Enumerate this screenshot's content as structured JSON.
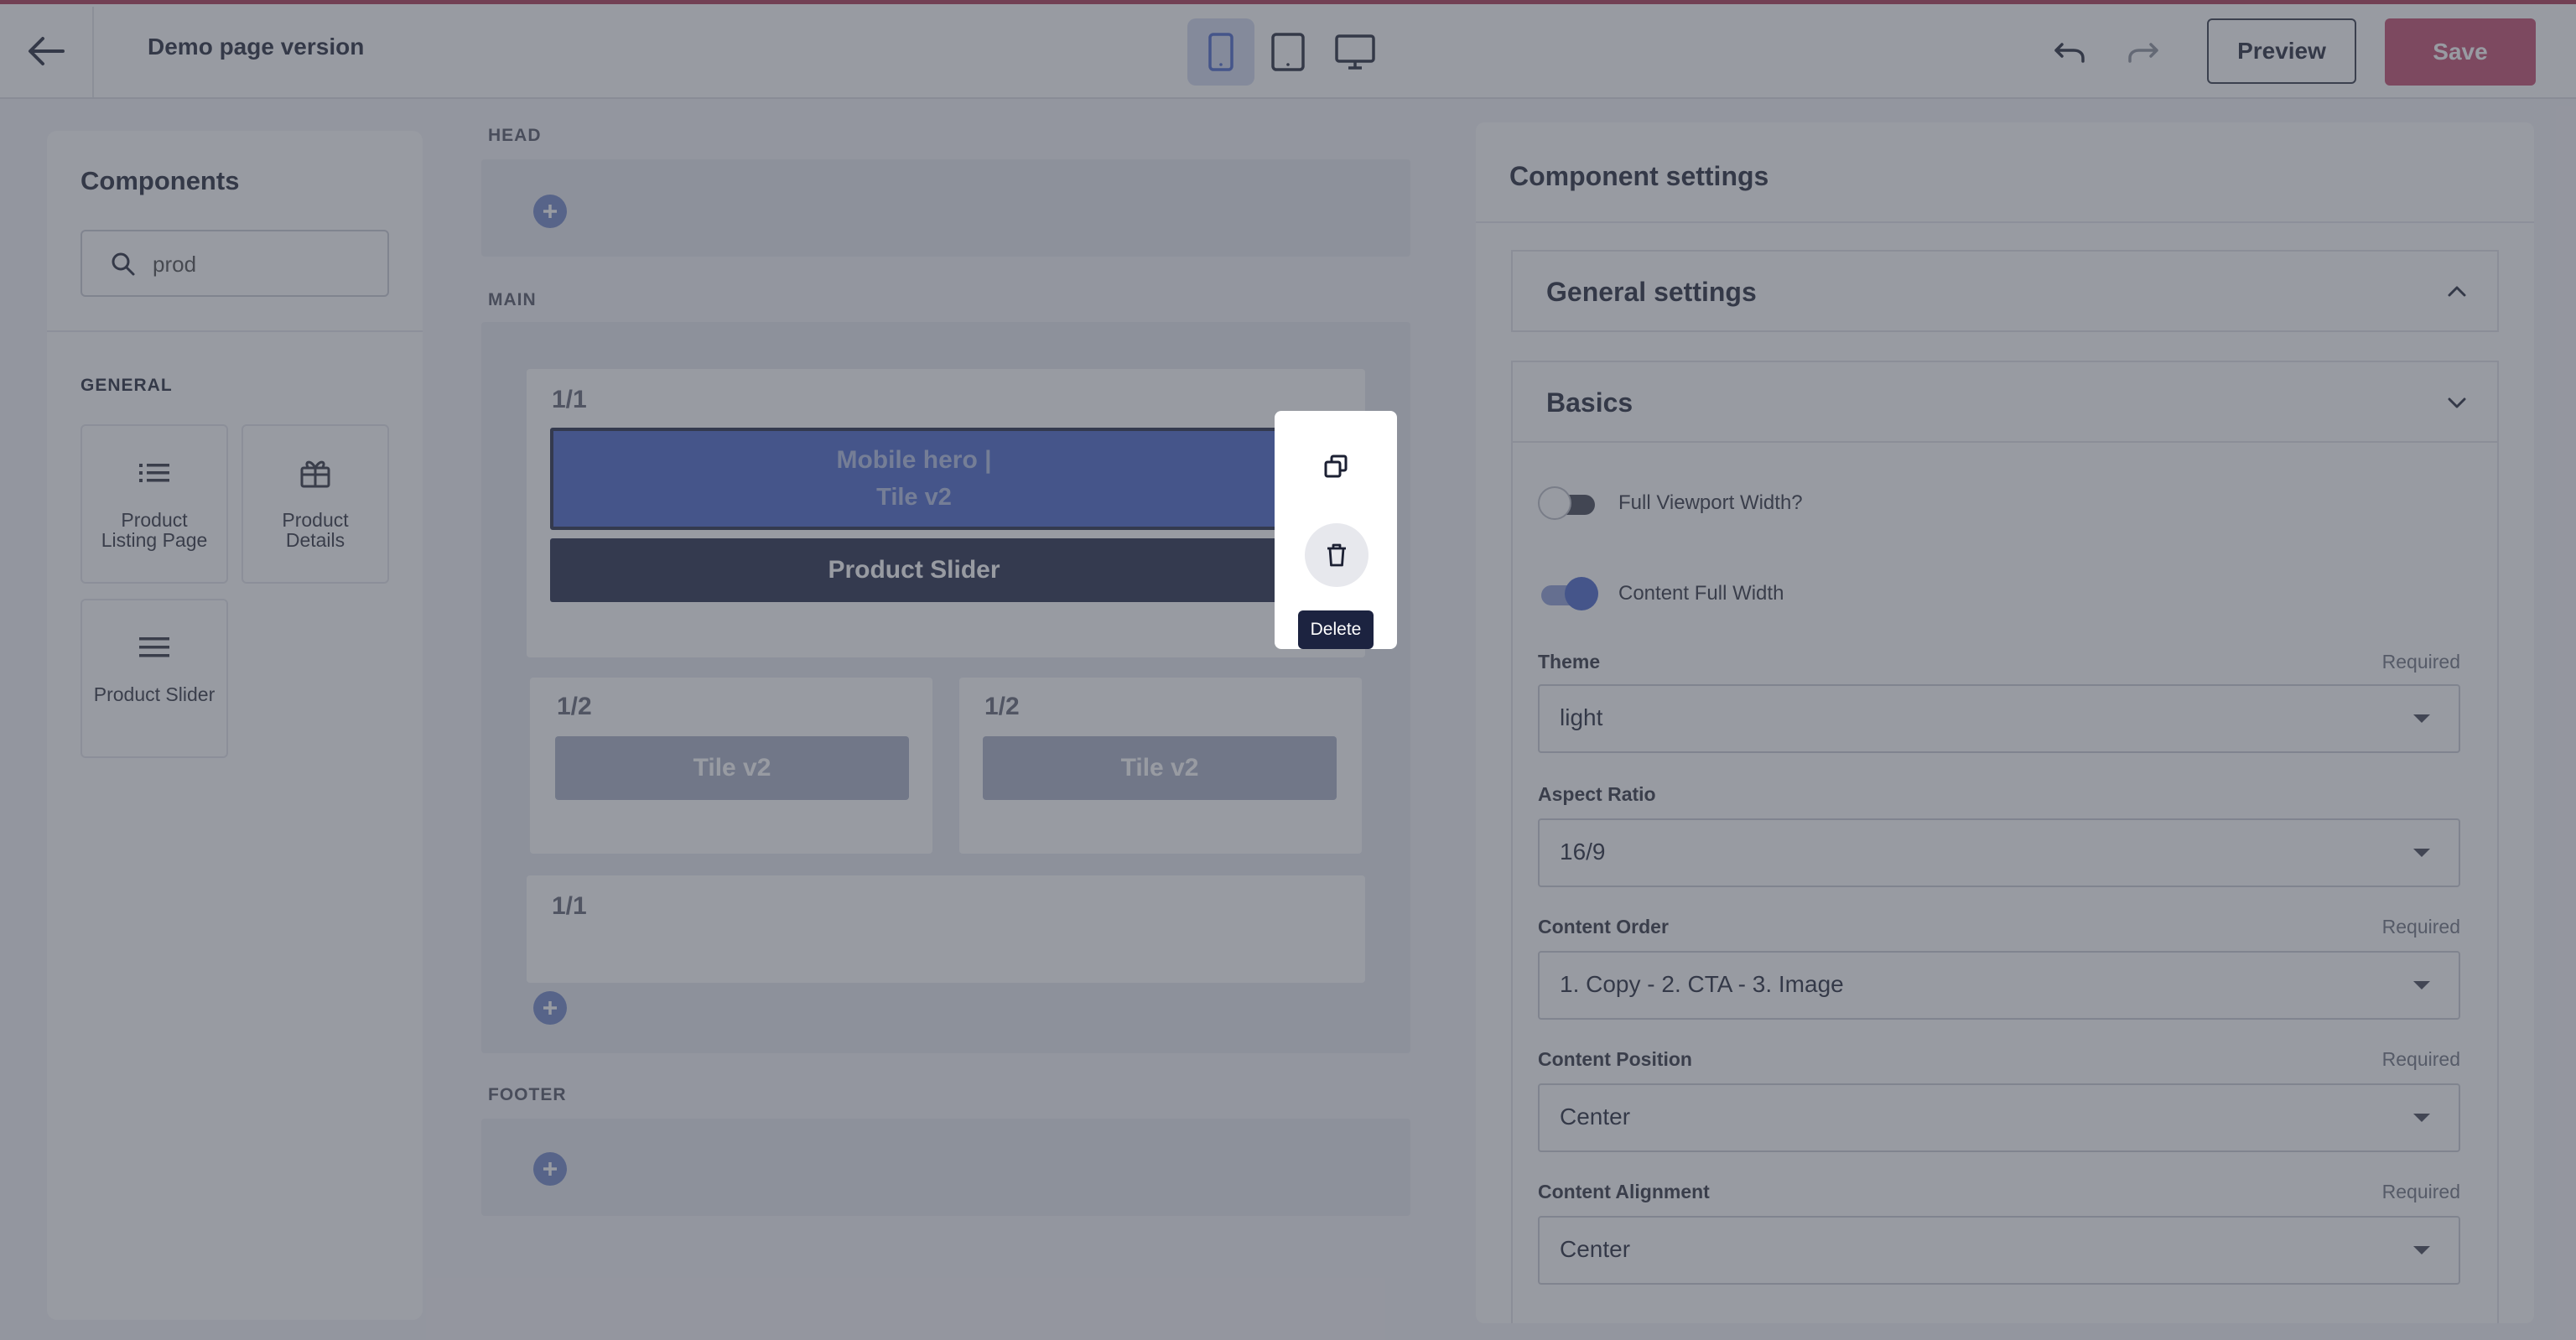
{
  "header": {
    "page_title": "Demo page version",
    "preview_label": "Preview",
    "save_label": "Save",
    "active_device": "mobile",
    "accent_color": "#c2456a"
  },
  "left_panel": {
    "title": "Components",
    "search": {
      "value": "prod",
      "placeholder": ""
    },
    "section_label": "GENERAL",
    "components": [
      {
        "label": "Product Listing Page",
        "icon": "list-icon"
      },
      {
        "label": "Product Details",
        "icon": "gift-icon"
      },
      {
        "label": "Product Slider",
        "icon": "menu-lines-icon"
      }
    ]
  },
  "canvas": {
    "head_label": "HEAD",
    "main_label": "MAIN",
    "footer_label": "FOOTER",
    "rows": [
      {
        "label": "1/1",
        "blocks": [
          "Mobile hero |",
          "Tile v2",
          "Product Slider"
        ]
      },
      {
        "label": "1/2",
        "blocks": [
          "Tile v2"
        ]
      },
      {
        "label": "1/2",
        "blocks": [
          "Tile v2"
        ]
      },
      {
        "label": "1/1",
        "blocks": []
      }
    ],
    "delete_tooltip": "Delete"
  },
  "right_panel": {
    "title": "Component settings",
    "general_settings_label": "General settings",
    "basics_label": "Basics",
    "toggles": [
      {
        "label": "Full Viewport Width?",
        "on": false
      },
      {
        "label": "Content Full Width",
        "on": true
      }
    ],
    "fields": [
      {
        "label": "Theme",
        "required": "Required",
        "value": "light"
      },
      {
        "label": "Aspect Ratio",
        "required": "",
        "value": "16/9"
      },
      {
        "label": "Content Order",
        "required": "Required",
        "value": "1. Copy - 2. CTA - 3. Image"
      },
      {
        "label": "Content Position",
        "required": "Required",
        "value": "Center"
      },
      {
        "label": "Content Alignment",
        "required": "Required",
        "value": "Center"
      }
    ]
  }
}
